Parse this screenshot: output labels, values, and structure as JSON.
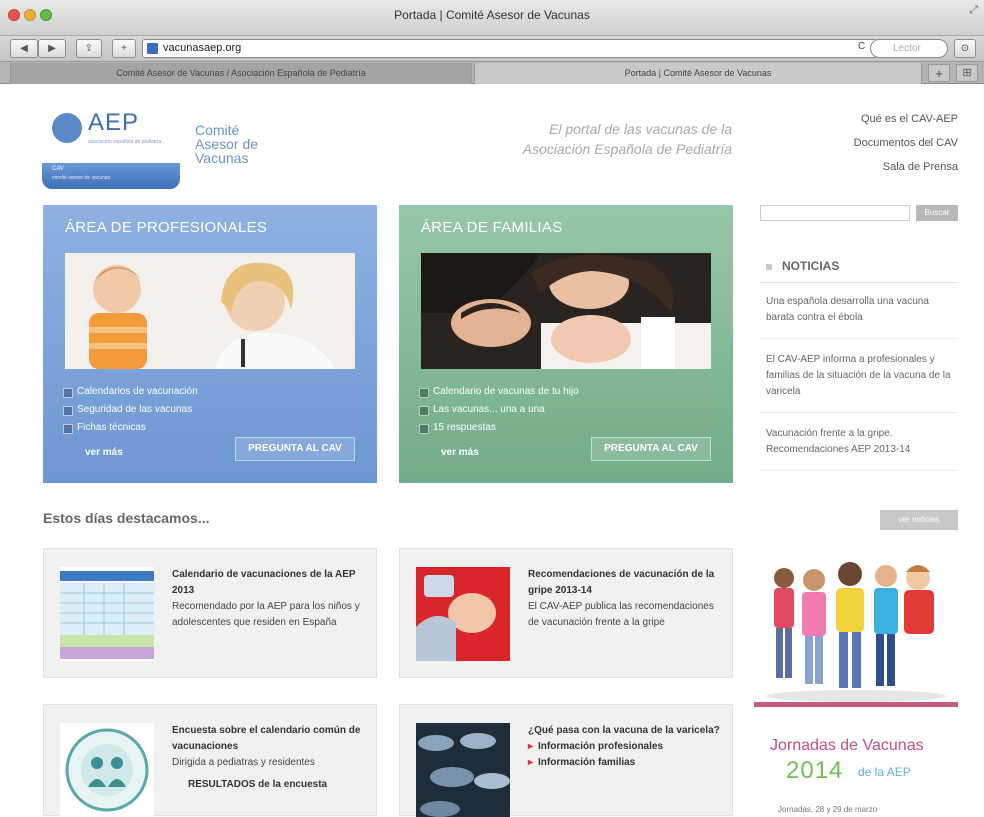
{
  "window": {
    "title": "Portada | Comité Asesor de Vacunas"
  },
  "toolbar": {
    "url": "vacunasaep.org",
    "reload": "C",
    "search_placeholder": "Lector"
  },
  "tabs": [
    {
      "label": "Comité Asesor de Vacunas / Asociación Española de Pediatría"
    },
    {
      "label": "Portada | Comité Asesor de Vacunas"
    }
  ],
  "header": {
    "logo_text": "AEP",
    "logo_tagline": "asociación española de pediatría",
    "logo_band_title": "CAV",
    "logo_band_sub": "comité asesor de vacunas",
    "committee_lines": [
      "Comité",
      "Asesor de",
      "Vacunas"
    ],
    "tagline_lines": [
      "El portal de las vacunas de la",
      "Asociación Española de Pediatría"
    ],
    "links": [
      "Qué es el CAV-AEP",
      "Documentos del CAV",
      "Sala de Prensa"
    ]
  },
  "areas": {
    "professionals": {
      "title": "ÁREA DE PROFESIONALES",
      "items": [
        "Calendarios de vacunación",
        "Seguridad de las vacunas",
        "Fichas técnicas"
      ],
      "more": "ver más",
      "ask": "PREGUNTA AL CAV"
    },
    "families": {
      "title": "ÁREA DE FAMILIAS",
      "items": [
        "Calendario de vacunas de tu hijo",
        "Las vacunas... una a una",
        "15 respuestas"
      ],
      "more": "ver más",
      "ask": "PREGUNTA AL CAV"
    }
  },
  "sidebar": {
    "search_button": "Buscar",
    "news_heading": "NOTICIAS",
    "news": [
      "Una española desarrolla una vacuna barata contra el ébola",
      "El CAV-AEP informa a profesionales y familias de la situación de la vacuna de la varicela",
      "Vacunación frente a la gripe. Recomendaciones AEP 2013-14"
    ]
  },
  "featured": {
    "heading": "Estos días destacamos...",
    "more_button": "ver noticias",
    "cards": [
      {
        "title": "Calendario de vacunaciones de la AEP 2013",
        "body": "Recomendado por la AEP para los niños y adolescentes que residen en España"
      },
      {
        "title": "Recomendaciones de vacunación de la gripe 2013-14",
        "body": "El CAV-AEP publica las recomendaciones de vacunación frente a la gripe"
      },
      {
        "title": "Encuesta sobre el calendario común de vacunaciones",
        "body": "Dirigida a pediatras y residentes",
        "link": "RESULTADOS de la encuesta"
      },
      {
        "title": "¿Qué pasa con la vacuna de la varicela?",
        "links": [
          "Información profesionales",
          "Información familias"
        ]
      }
    ]
  },
  "ad": {
    "title": "Jornadas de Vacunas",
    "year": "2014",
    "org": "de la AEP",
    "date": "Jornadas, 28 y 29 de marzo"
  },
  "colors": {
    "professionals": "#7ea4da",
    "families": "#85ba98",
    "logo_blue": "#3f6db0",
    "accent_red": "#d43b2a"
  }
}
